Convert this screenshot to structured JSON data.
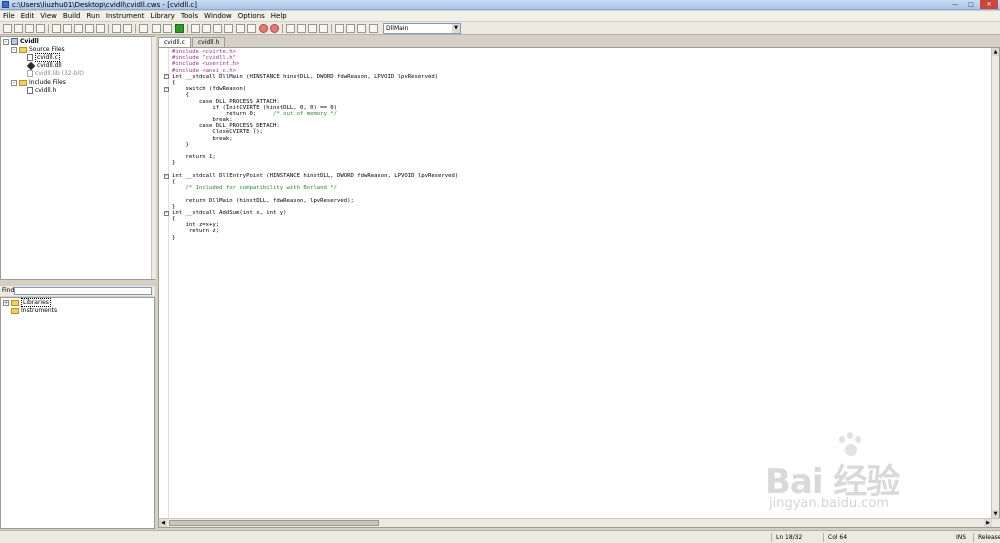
{
  "window": {
    "title": "c:\\Users\\liuzhu01\\Desktop\\cvidll\\cvidll.cws - [cvidll.c]"
  },
  "menu": [
    "File",
    "Edit",
    "View",
    "Build",
    "Run",
    "Instrument",
    "Library",
    "Tools",
    "Window",
    "Options",
    "Help"
  ],
  "toolbar": {
    "function_select": "DllMain"
  },
  "project_tree": {
    "root": "Cvidll",
    "source_folder": "Source Files",
    "source_files": [
      "cvidll.c",
      "cvidll.dll",
      "cvidll.lib (32-bit)"
    ],
    "include_folder": "Include Files",
    "include_files": [
      "cvidll.h"
    ]
  },
  "find": {
    "label": "Find",
    "value": ""
  },
  "library_tree": {
    "items": [
      "Libraries",
      "Instruments"
    ]
  },
  "editor": {
    "tabs": [
      "cvidll.c",
      "cvidll.h"
    ],
    "code_lines": [
      "#include <cvirte.h>",
      "#include \"cvidll.h\"",
      "#include <userint.h>",
      "#include <ansi_c.h>",
      "int __stdcall DllMain (HINSTANCE hinstDLL, DWORD fdwReason, LPVOID lpvReserved)",
      "{",
      "    switch (fdwReason)",
      "    {",
      "        case DLL_PROCESS_ATTACH:",
      "            if (InitCVIRTE (hinstDLL, 0, 0) == 0)",
      "                return 0;     /* out of memory */",
      "            break;",
      "        case DLL_PROCESS_DETACH:",
      "            CloseCVIRTE ();",
      "            break;",
      "    }",
      "",
      "    return 1;",
      "}",
      "",
      "int __stdcall DllEntryPoint (HINSTANCE hinstDLL, DWORD fdwReason, LPVOID lpvReserved)",
      "{",
      "    /* Included for compatibility with Borland */",
      "",
      "    return DllMain (hinstDLL, fdwReason, lpvReserved);",
      "}",
      "int __stdcall AddSum(int x, int y)",
      "{",
      "    int z=x+y;",
      "     return z;",
      "}"
    ]
  },
  "status": {
    "line": "Ln 18/32",
    "col": "Col 64",
    "ins": "INS",
    "config": "Release"
  },
  "watermark": {
    "brand": "Bai  经验",
    "url": "jingyan.baidu.com"
  }
}
